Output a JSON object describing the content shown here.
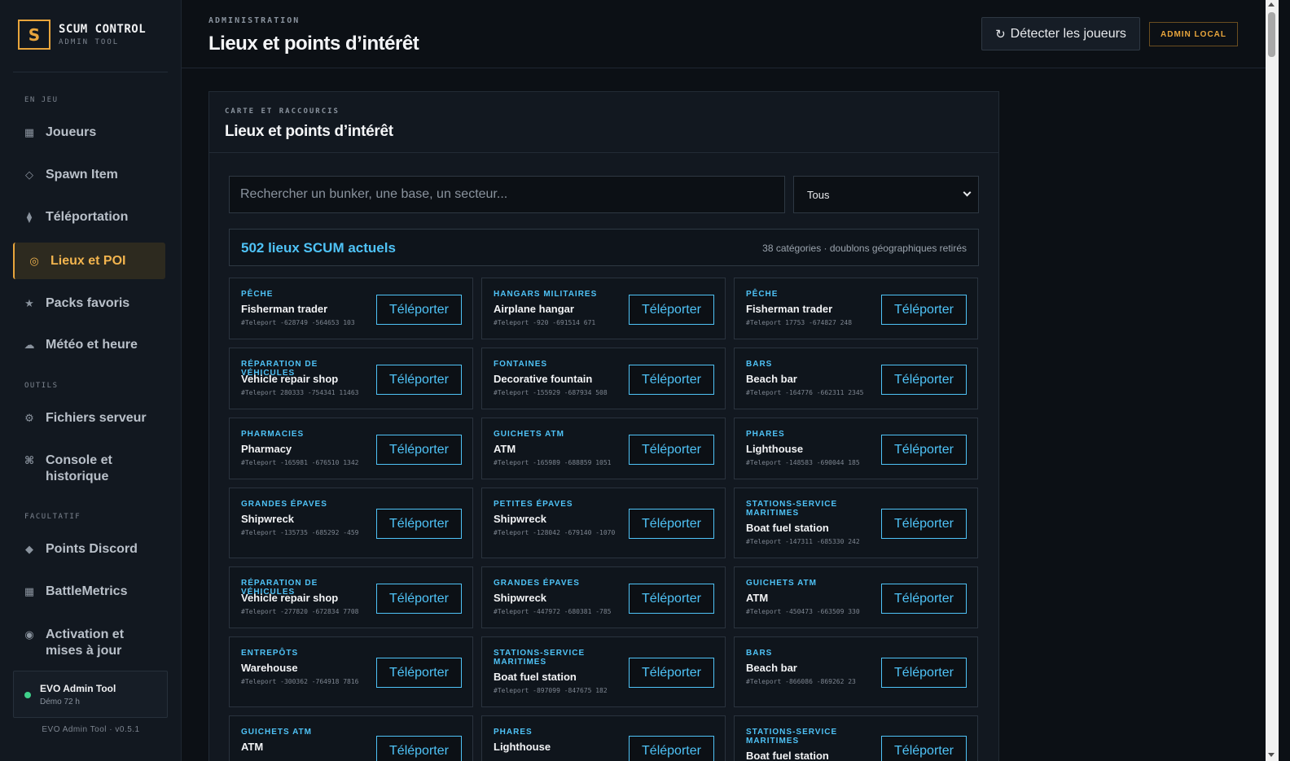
{
  "brand": {
    "logo_letter": "S",
    "name": "SCUM CONTROL",
    "sub": "ADMIN TOOL"
  },
  "sidebar": {
    "section_game": "EN JEU",
    "section_tools": "OUTILS",
    "section_optional": "FACULTATIF",
    "items": [
      {
        "label": "Joueurs",
        "icon": "▦"
      },
      {
        "label": "Spawn Item",
        "icon": "◇"
      },
      {
        "label": "Téléportation",
        "icon": "⧫"
      },
      {
        "label": "Lieux et POI",
        "icon": "◎"
      },
      {
        "label": "Packs favoris",
        "icon": "★"
      },
      {
        "label": "Météo et heure",
        "icon": "☁"
      },
      {
        "label": "Fichiers serveur",
        "icon": "⚙"
      },
      {
        "label": "Console et historique",
        "icon": "⌘"
      },
      {
        "label": "Points Discord",
        "icon": "◆"
      },
      {
        "label": "BattleMetrics",
        "icon": "▦"
      },
      {
        "label": "Activation et mises à jour",
        "icon": "◉"
      }
    ],
    "status_name": "EVO Admin Tool",
    "status_sub": "Démo 72 h",
    "version": "EVO Admin Tool · v0.5.1"
  },
  "topbar": {
    "eyebrow": "ADMINISTRATION",
    "title": "Lieux et points d’intérêt",
    "detect_icon": "↻",
    "detect_label": "Détecter les joueurs",
    "admin_badge": "ADMIN LOCAL"
  },
  "panel": {
    "eyebrow": "CARTE ET RACCOURCIS",
    "title": "Lieux et points d’intérêt",
    "search_placeholder": "Rechercher un bunker, une base, un secteur...",
    "filter_value": "Tous",
    "count_title": "502 lieux SCUM actuels",
    "count_meta": "38 catégories · doublons géographiques retirés",
    "button_label": "Téléporter"
  },
  "locations": [
    {
      "category": "Pêche",
      "name": "Fisherman trader",
      "command": "#Teleport -628749 -564653 103"
    },
    {
      "category": "Hangars militaires",
      "name": "Airplane hangar",
      "command": "#Teleport -920 -691514 671"
    },
    {
      "category": "Pêche",
      "name": "Fisherman trader",
      "command": "#Teleport 17753 -674827 248"
    },
    {
      "category": "Réparation de véhicules",
      "name": "Vehicle repair shop",
      "command": "#Teleport 280333 -754341 11463"
    },
    {
      "category": "Fontaines",
      "name": "Decorative fountain",
      "command": "#Teleport -155929 -687934 508"
    },
    {
      "category": "Bars",
      "name": "Beach bar",
      "command": "#Teleport -164776 -662311 2345"
    },
    {
      "category": "Pharmacies",
      "name": "Pharmacy",
      "command": "#Teleport -165981 -676510 1342"
    },
    {
      "category": "Guichets ATM",
      "name": "ATM",
      "command": "#Teleport -165989 -688859 1051"
    },
    {
      "category": "Phares",
      "name": "Lighthouse",
      "command": "#Teleport -148583 -690044 185"
    },
    {
      "category": "Grandes épaves",
      "name": "Shipwreck",
      "command": "#Teleport -135735 -685292 -459"
    },
    {
      "category": "Petites épaves",
      "name": "Shipwreck",
      "command": "#Teleport -128042 -679140 -1070"
    },
    {
      "category": "Stations-service maritimes",
      "name": "Boat fuel station",
      "command": "#Teleport -147311 -685330 242"
    },
    {
      "category": "Réparation de véhicules",
      "name": "Vehicle repair shop",
      "command": "#Teleport -277820 -672834 7708"
    },
    {
      "category": "Grandes épaves",
      "name": "Shipwreck",
      "command": "#Teleport -447972 -680381 -785"
    },
    {
      "category": "Guichets ATM",
      "name": "ATM",
      "command": "#Teleport -450473 -663509 330"
    },
    {
      "category": "Entrepôts",
      "name": "Warehouse",
      "command": "#Teleport -300362 -764918 7816"
    },
    {
      "category": "Stations-service maritimes",
      "name": "Boat fuel station",
      "command": "#Teleport -897099 -847675 182"
    },
    {
      "category": "Bars",
      "name": "Beach bar",
      "command": "#Teleport -866086 -869262 23"
    },
    {
      "category": "Guichets ATM",
      "name": "ATM",
      "command": ""
    },
    {
      "category": "Phares",
      "name": "Lighthouse",
      "command": ""
    },
    {
      "category": "Stations-service maritimes",
      "name": "Boat fuel station",
      "command": ""
    }
  ]
}
